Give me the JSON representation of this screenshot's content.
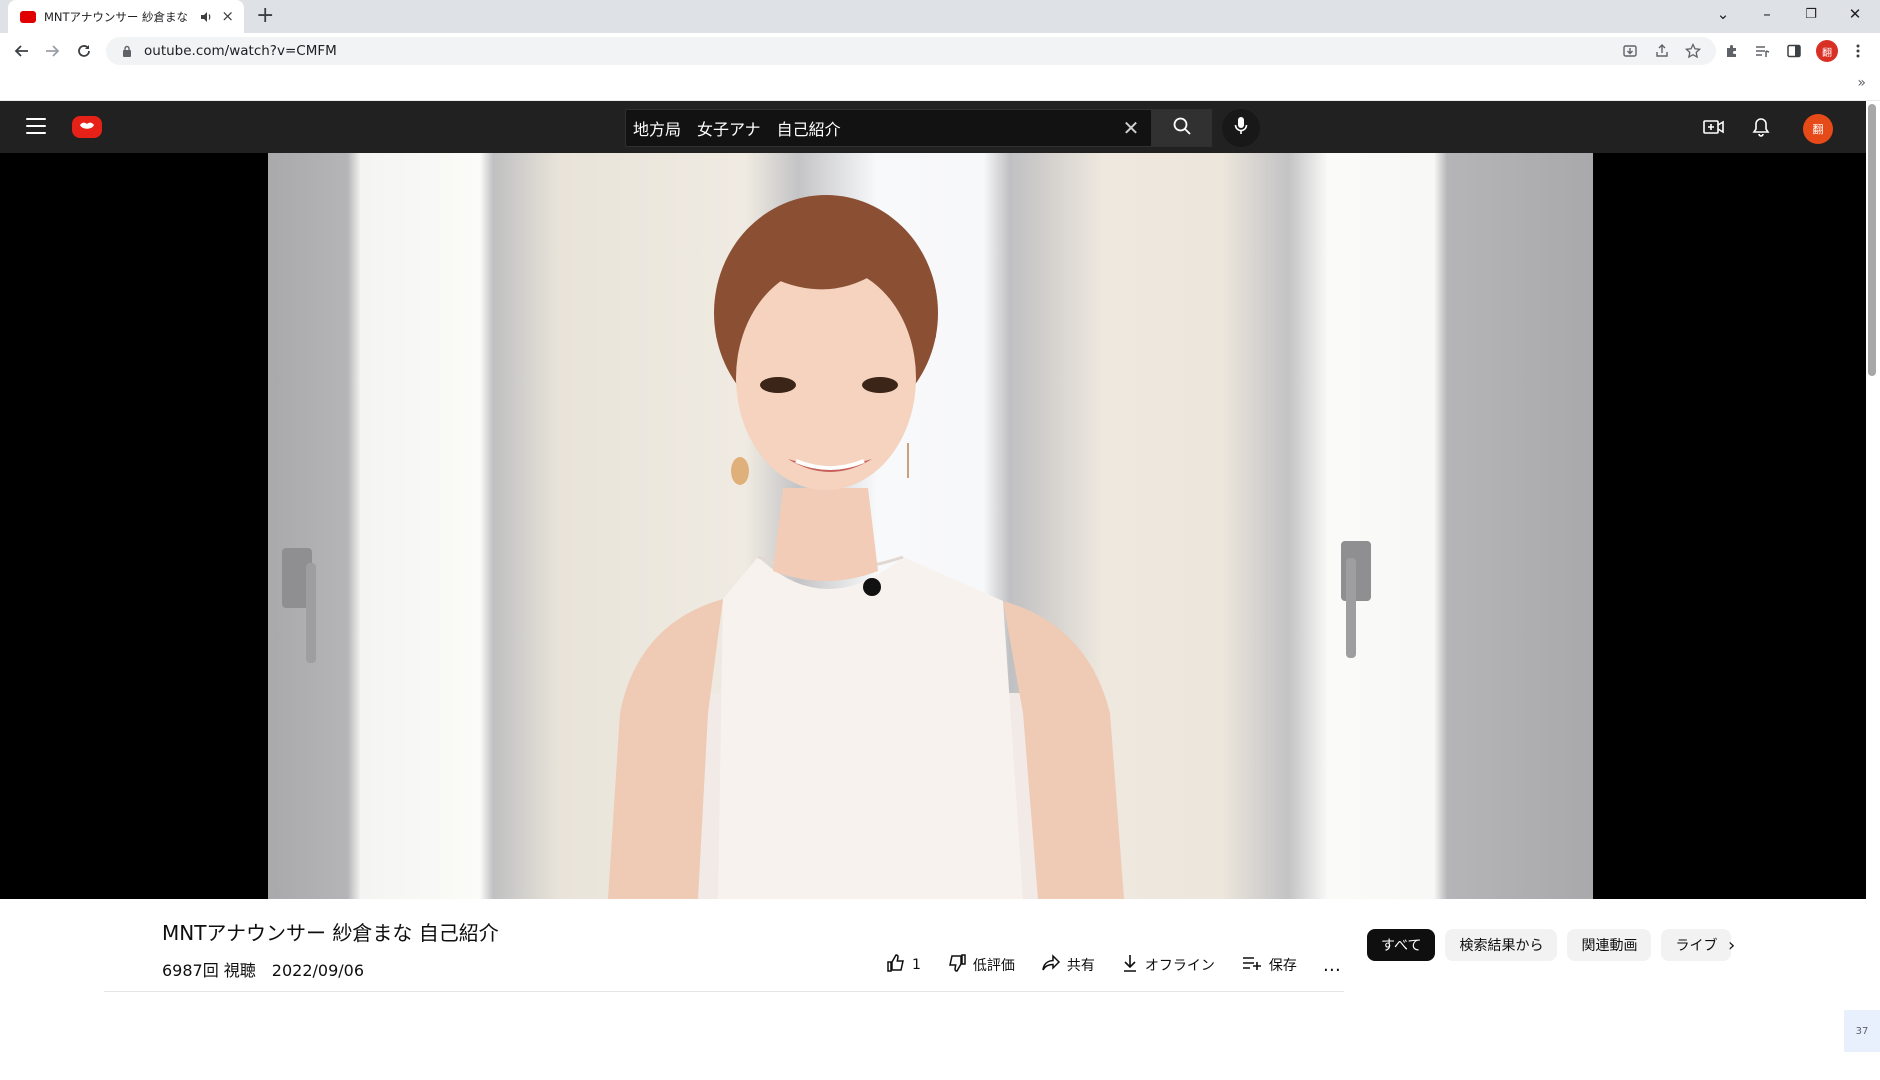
{
  "browser": {
    "tab_title": "MNTアナウンサー 紗倉まな",
    "tab_close": "×",
    "new_tab": "+",
    "url": "outube.com/watch?v=CMFM",
    "profile_initial": "翻",
    "bookmarks_more": "»"
  },
  "window_controls": {
    "dropdown": "⌄",
    "minimize": "–",
    "restore": "❐",
    "close": "✕"
  },
  "header": {
    "search_query": "地方局　女子アナ　自己紹介",
    "clear_glyph": "✕",
    "avatar_initial": "翻"
  },
  "video": {
    "title": "MNTアナウンサー 紗倉まな 自己紹介",
    "views_date": "6987回 視聴　2022/09/06"
  },
  "actions": {
    "like_count": "1",
    "dislike_label": "低評価",
    "share_label": "共有",
    "offline_label": "オフライン",
    "save_label": "保存",
    "more_label": "…"
  },
  "chips": {
    "all": "すべて",
    "from_search": "検索結果から",
    "related": "関連動画",
    "live": "ライブ",
    "next": "›"
  },
  "corner_badge": "37",
  "colors": {
    "header_bg": "#212121",
    "brand_red": "#e62117",
    "avatar": "#e64a19"
  }
}
